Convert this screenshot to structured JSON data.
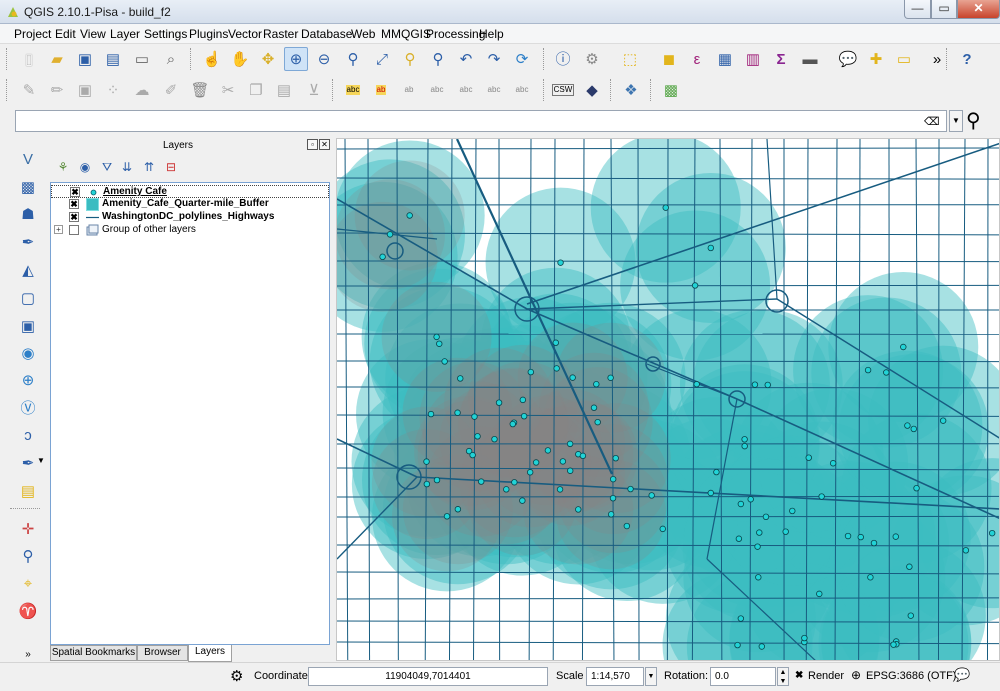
{
  "window": {
    "title": "QGIS 2.10.1-Pisa - build_f2",
    "min": "—",
    "max": "▭",
    "close": "✕"
  },
  "menu": [
    "Project",
    "Edit",
    "View",
    "Layer",
    "Settings",
    "Plugins",
    "Vector",
    "Raster",
    "Database",
    "Web",
    "MMQGIS",
    "Processing",
    "Help"
  ],
  "toolbar1_icons": [
    "new-project-icon",
    "open-project-icon",
    "save-project-icon",
    "save-as-icon",
    "print-composer-icon",
    "composer-manager-icon",
    "touch-icon",
    "pan-icon",
    "pan-to-selection-icon",
    "zoom-in-icon",
    "zoom-out-icon",
    "zoom-native-icon",
    "zoom-full-icon",
    "zoom-selection-icon",
    "zoom-layer-icon",
    "zoom-last-icon",
    "zoom-next-icon",
    "refresh-icon",
    "identify-icon",
    "map-tips-icon",
    "select-features-icon",
    "deselect-icon",
    "field-calculator-icon",
    "attribute-table-icon",
    "statistics-icon",
    "sum-icon",
    "measure-icon",
    "annotation-icon",
    "new-bookmark-icon",
    "show-bookmarks-icon",
    "help-icon",
    "more-icon"
  ],
  "toolbar2_icons": [
    "current-edits-icon",
    "toggle-editing-icon",
    "save-edits-icon",
    "add-feature-icon",
    "move-feature-icon",
    "node-tool-icon",
    "delete-selected-icon",
    "cut-features-icon",
    "copy-features-icon",
    "paste-features-icon",
    "label-icon",
    "label-highlight-icon",
    "pin-labels-icon",
    "show-hide-labels-icon",
    "move-label-icon",
    "rotate-label-icon",
    "change-label-icon",
    "csw-icon",
    "metasearch-icon",
    "python-console-icon",
    "georeferencer-icon"
  ],
  "toolbar2_texts": {
    "csw": "CSW"
  },
  "search": {
    "value": "",
    "clear": "⌫",
    "drop": "▼"
  },
  "left_tools": [
    "digitize-icon",
    "add-raster-icon",
    "add-postgis-icon",
    "add-spatialite-icon",
    "add-mssql-icon",
    "add-oracle-icon",
    "add-db2-icon",
    "add-wms-icon",
    "add-wcs-icon",
    "add-wfs-icon",
    "add-delimited-text-icon",
    "new-shapefile-icon",
    "add-virtual-layer-icon",
    "georef-point-icon",
    "spatial-query-icon",
    "coordinate-capture-icon",
    "gps-icon",
    "expand-icon"
  ],
  "layers_panel": {
    "title": "Layers",
    "float_btn": "▫",
    "close_btn": "✕",
    "tools": [
      "add-group-icon",
      "manage-visibility-icon",
      "filter-legend-icon",
      "expand-all-icon",
      "collapse-all-icon",
      "remove-layer-icon"
    ],
    "tree": [
      {
        "label": "Amenity Cafe",
        "checked": "✖",
        "bold": true,
        "symbol": "point"
      },
      {
        "label": "Amenity_Cafe_Quarter-mile_Buffer",
        "checked": "✖",
        "bold": true,
        "symbol": "polygon"
      },
      {
        "label": "WashingtonDC_polylines_Highways",
        "checked": "✖",
        "bold": true,
        "symbol": "line"
      },
      {
        "label": "Group of other layers",
        "checked": "",
        "bold": false,
        "symbol": "group",
        "expander": "+"
      }
    ],
    "tabs": [
      "Spatial Bookmarks",
      "Browser",
      "Layers"
    ]
  },
  "colors": {
    "buffer_fill": "#3bbcc1",
    "buffer_overlap": "#8a8585",
    "highway_line": "#175c80",
    "cafe_point": "#22d3d6",
    "map_bg": "#ffffff"
  },
  "status": {
    "coordinate_label": "Coordinate:",
    "coordinate_value": "11904049,7014401",
    "scale_label": "Scale",
    "scale_value": "1:14,570",
    "rotation_label": "Rotation:",
    "rotation_value": "0.0",
    "render_label": "Render",
    "render_checked": "✖",
    "crs": "EPSG:3686 (OTF)"
  }
}
